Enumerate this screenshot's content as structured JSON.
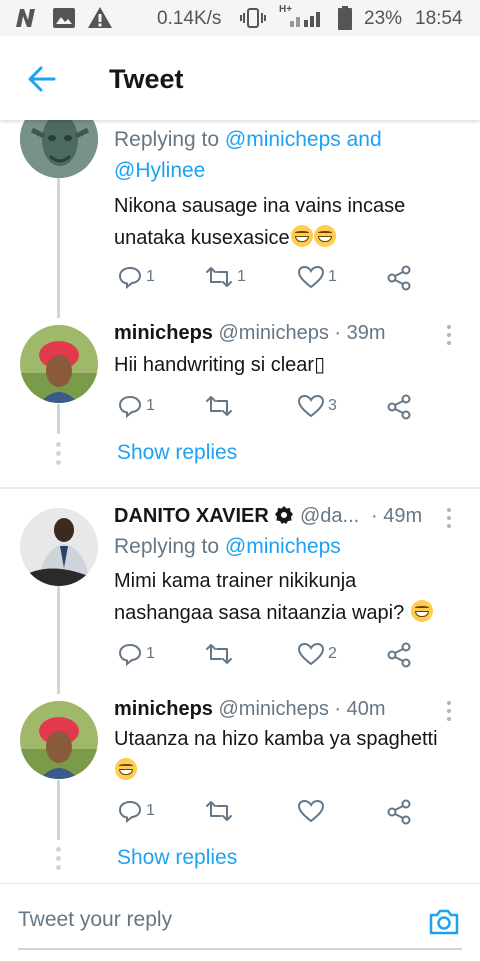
{
  "status_bar": {
    "speed": "0.14K/s",
    "battery": "23%",
    "time": "18:54",
    "network_type": "H+"
  },
  "header": {
    "title": "Tweet",
    "back_icon": "back-arrow-icon"
  },
  "tweets": [
    {
      "replying_prefix": "Replying to",
      "replying_handles": "@minicheps and",
      "replying_handles_2": "@Hylinee",
      "text_lines": [
        "Nikona sausage ina vains incase",
        "unataka kusexasice"
      ],
      "emojis": [
        "😂",
        "😂"
      ],
      "actions": {
        "reply": "1",
        "retweet": "1",
        "like": "1",
        "share": ""
      }
    },
    {
      "name": "minicheps",
      "handle": "@minicheps",
      "time": "· 39m",
      "text_lines": [
        "Hii handwriting si clear▯"
      ],
      "actions": {
        "reply": "1",
        "retweet": "",
        "like": "3",
        "share": ""
      },
      "show_replies": "Show replies"
    },
    {
      "name": "DANITO XAVIER",
      "verified_icon": "badge-icon",
      "handle": "@da...",
      "time": "· 49m",
      "replying_prefix": "Replying to",
      "replying_handles": "@minicheps",
      "text_lines": [
        "Mimi kama trainer nikikunja",
        "nashangaa sasa nitaanzia wapi?"
      ],
      "emojis": [
        "😂"
      ],
      "actions": {
        "reply": "1",
        "retweet": "",
        "like": "2",
        "share": ""
      }
    },
    {
      "name": "minicheps",
      "handle": "@minicheps",
      "time": "· 40m",
      "text_lines": [
        "Utaanza na hizo kamba ya spaghetti"
      ],
      "emojis": [
        "😂"
      ],
      "actions": {
        "reply": "1",
        "retweet": "",
        "like": "",
        "share": ""
      },
      "show_replies": "Show replies"
    }
  ],
  "reply_bar": {
    "placeholder": "Tweet your reply",
    "camera_icon": "camera-icon"
  },
  "colors": {
    "accent": "#1da1f2",
    "secondary_text": "#657786",
    "primary_text": "#14171a"
  }
}
